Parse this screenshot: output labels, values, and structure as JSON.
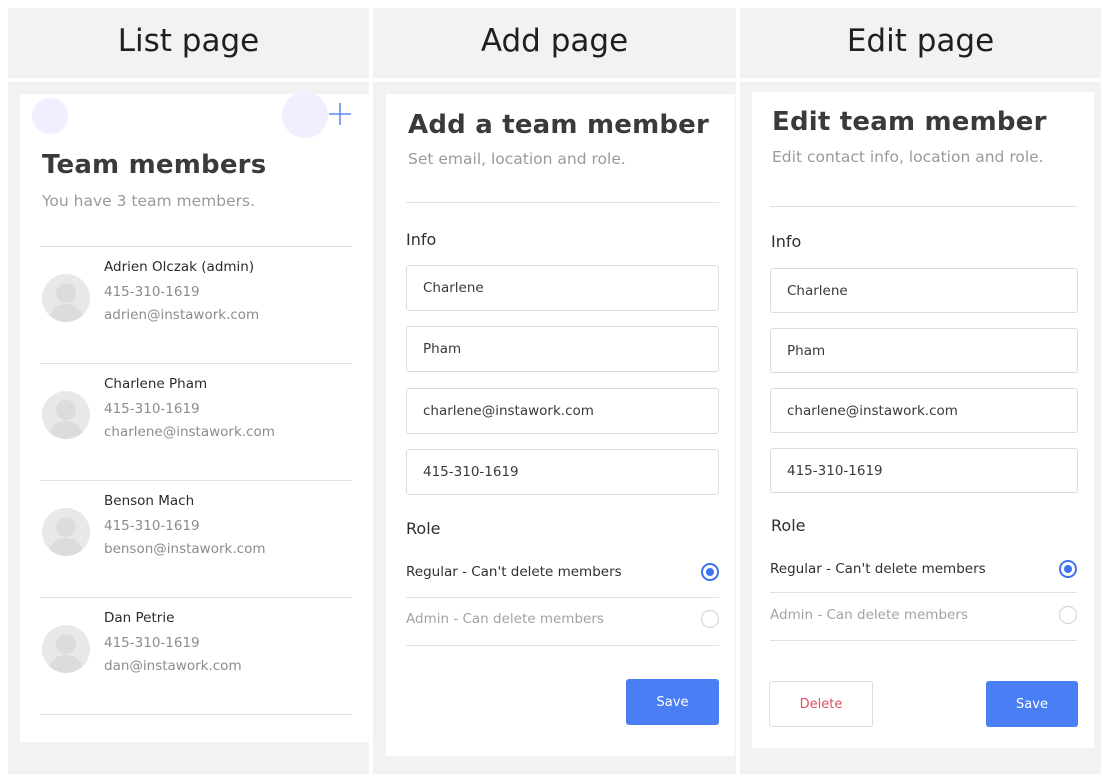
{
  "columns": {
    "list": {
      "header": "List page"
    },
    "add": {
      "header": "Add page"
    },
    "edit": {
      "header": "Edit page"
    }
  },
  "list_page": {
    "title": "Team members",
    "subtitle": "You have 3 team members.",
    "add_icon": "plus-icon",
    "members": [
      {
        "name": "Adrien Olczak (admin)",
        "phone": "415-310-1619",
        "email": "adrien@instawork.com"
      },
      {
        "name": "Charlene Pham",
        "phone": "415-310-1619",
        "email": "charlene@instawork.com"
      },
      {
        "name": "Benson Mach",
        "phone": "415-310-1619",
        "email": "benson@instawork.com"
      },
      {
        "name": "Dan Petrie",
        "phone": "415-310-1619",
        "email": "dan@instawork.com"
      }
    ]
  },
  "add_page": {
    "title": "Add a team member",
    "subtitle": "Set email, location and role.",
    "info_label": "Info",
    "fields": {
      "first_name": "Charlene",
      "last_name": "Pham",
      "email": "charlene@instawork.com",
      "phone": "415-310-1619"
    },
    "role_label": "Role",
    "roles": [
      {
        "label": "Regular - Can't delete members",
        "selected": true
      },
      {
        "label": "Admin - Can delete members",
        "selected": false
      }
    ],
    "save_label": "Save"
  },
  "edit_page": {
    "title": "Edit team member",
    "subtitle": "Edit contact info, location and role.",
    "info_label": "Info",
    "fields": {
      "first_name": "Charlene",
      "last_name": "Pham",
      "email": "charlene@instawork.com",
      "phone": "415-310-1619"
    },
    "role_label": "Role",
    "roles": [
      {
        "label": "Regular - Can't delete members",
        "selected": true
      },
      {
        "label": "Admin - Can delete members",
        "selected": false
      }
    ],
    "delete_label": "Delete",
    "save_label": "Save"
  },
  "colors": {
    "accent": "#4a7ef5",
    "danger": "#e0505f",
    "panel_bg": "#f2f2f2"
  }
}
